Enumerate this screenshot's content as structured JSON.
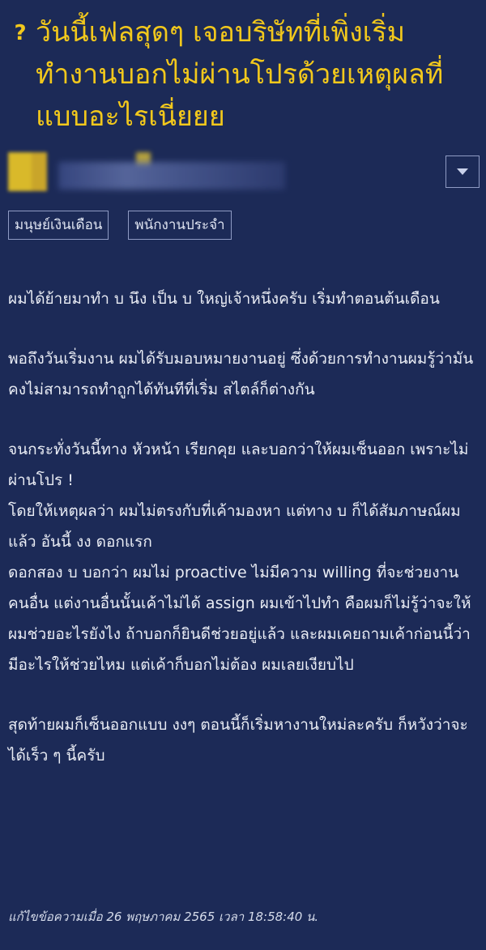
{
  "topic": {
    "title": "วันนี้เฟลสุดๆ เจอบริษัทที่เพิ่งเริ่มทำงานบอกไม่ผ่านโปรด้วยเหตุผลที่แบบอะไรเนี่ยยย",
    "question_marker": "?"
  },
  "author": {
    "avatar_icon": "blurred-avatar",
    "dropdown_icon": "chevron-down-icon"
  },
  "tags": [
    "มนุษย์เงินเดือน",
    "พนักงานประจำ"
  ],
  "body": {
    "paragraphs": [
      "ผมได้ย้ายมาทำ บ นึง เป็น บ ใหญ่เจ้าหนึ่งครับ เริ่มทำตอนต้นเดือน",
      "พอถึงวันเริ่มงาน ผมได้รับมอบหมายงานอยู่ ซึ่งด้วยการทำงานผมรู้ว่ามันคงไม่สามารถทำถูกได้ทันทีที่เริ่ม สไตล์ก็ต่างกัน",
      "จนกระทั่งวันนี้ทาง หัวหน้า เรียกคุย และบอกว่าให้ผมเซ็นออก เพราะไม่ผ่านโปร !\nโดยให้เหตุผลว่า ผมไม่ตรงกับที่เค้ามองหา แต่ทาง บ ก็ได้สัมภาษณ์ผมแล้ว อันนี้ งง ดอกแรก\nดอกสอง บ บอกว่า ผมไม่ proactive ไม่มีความ willing ที่จะช่วยงานคนอื่น แต่งานอื่นนั้นเค้าไม่ได้ assign ผมเข้าไปทำ คือผมก็ไม่รู้ว่าจะให้ผมช่วยอะไรยังไง ถ้าบอกก็ยินดีช่วยอยู่แล้ว และผมเคยถามเค้าก่อนนี้ว่ามีอะไรให้ช่วยไหม แต่เค้าก็บอกไม่ต้อง ผมเลยเงียบไป",
      "สุดท้ายผมก็เซ็นออกแบบ งงๆ ตอนนี้ก็เริ่มหางานใหม่ละครับ ก็หวังว่าจะได้เร็ว ๆ นี้ครับ"
    ]
  },
  "edited_note": "แก้ไขข้อความเมื่อ 26 พฤษภาคม 2565 เวลา 18:58:40 น.",
  "colors": {
    "background": "#1c2a57",
    "title": "#f2c81c",
    "text": "#e9ecf4",
    "border": "#8f9bc4"
  }
}
